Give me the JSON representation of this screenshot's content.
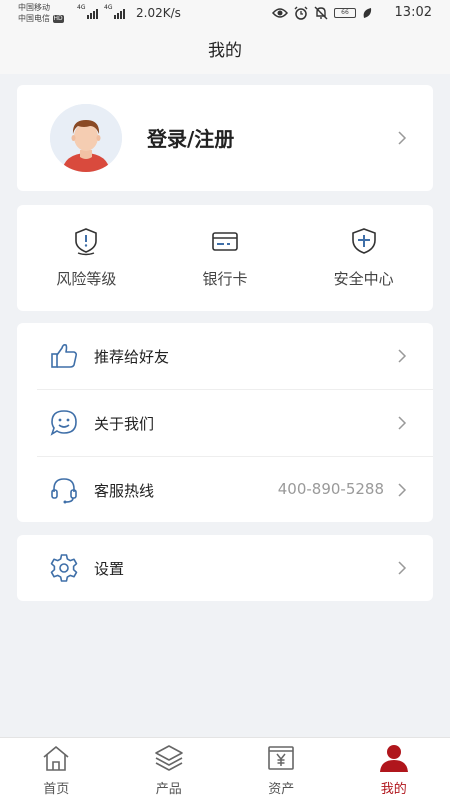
{
  "status_bar": {
    "carrier_1": "中国移动",
    "carrier_2": "中国电信",
    "hd_badge": "HD",
    "signal_tag_1": "4G",
    "signal_tag_2": "4G",
    "net_speed": "2.02K/s",
    "battery_level": "66",
    "time": "13:02"
  },
  "nav": {
    "title": "我的"
  },
  "profile": {
    "login_label": "登录/注册"
  },
  "quick_actions": [
    {
      "label": "风险等级",
      "icon": "shield-alert-icon"
    },
    {
      "label": "银行卡",
      "icon": "bank-card-icon"
    },
    {
      "label": "安全中心",
      "icon": "security-shield-icon"
    }
  ],
  "menu": {
    "recommend": {
      "label": "推荐给好友",
      "icon": "thumbs-up-icon"
    },
    "about": {
      "label": "关于我们",
      "icon": "smiley-chat-icon"
    },
    "hotline": {
      "label": "客服热线",
      "value": "400-890-5288",
      "icon": "headset-icon"
    },
    "settings": {
      "label": "设置",
      "icon": "gear-icon"
    }
  },
  "tabs": [
    {
      "label": "首页",
      "icon": "home-icon",
      "active": false
    },
    {
      "label": "产品",
      "icon": "layers-icon",
      "active": false
    },
    {
      "label": "资产",
      "icon": "yen-box-icon",
      "active": false
    },
    {
      "label": "我的",
      "icon": "person-icon",
      "active": true
    }
  ],
  "colors": {
    "accent_red": "#b0161c",
    "icon_blue": "#3f6fa8",
    "background": "#f0f2f5"
  }
}
